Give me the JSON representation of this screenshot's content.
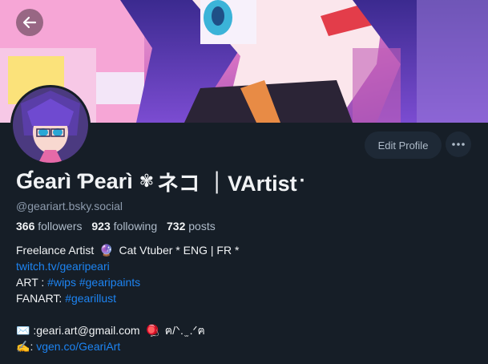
{
  "header": {
    "back_icon": "arrow-left-icon"
  },
  "profile": {
    "name_prefix": "Ɠearì Ƥearì",
    "name_flower": "✾",
    "name_suffix": "ネコ ｜VArtist",
    "name_dot": "·",
    "handle": "@geariart.bsky.social",
    "edit_label": "Edit Profile",
    "more_label": "•••",
    "stats": {
      "followers_count": "366",
      "followers_label": "followers",
      "following_count": "923",
      "following_label": "following",
      "posts_count": "732",
      "posts_label": "posts"
    }
  },
  "bio": {
    "line1_a": " Freelance Artist",
    "line1_emoji": "🔮",
    "line1_b": "Cat Vtuber  *  ENG | FR  *",
    "line2_link": "twitch.tv/gearipeari",
    "line3_label": "ART : ",
    "line3_tag1": "#wips",
    "line3_tag2": "#gearipaints",
    "line4_label": "FANART: ",
    "line4_tag": "#gearillust",
    "line6_emoji": "✉️",
    "line6_text": " :geari.art@gmail.com",
    "line6_emoji2": "🪀",
    "line6_kaomoji": " ฅ/ᐠ. ̫ .ᐟฅ",
    "line7_emoji": "✍️",
    "line7_sep": ": ",
    "line7_link": "vgen.co/GeariArt"
  },
  "colors": {
    "background": "#161e27",
    "link": "#1d84f2",
    "text": "#f1f3f5",
    "muted": "#8d9bad"
  }
}
